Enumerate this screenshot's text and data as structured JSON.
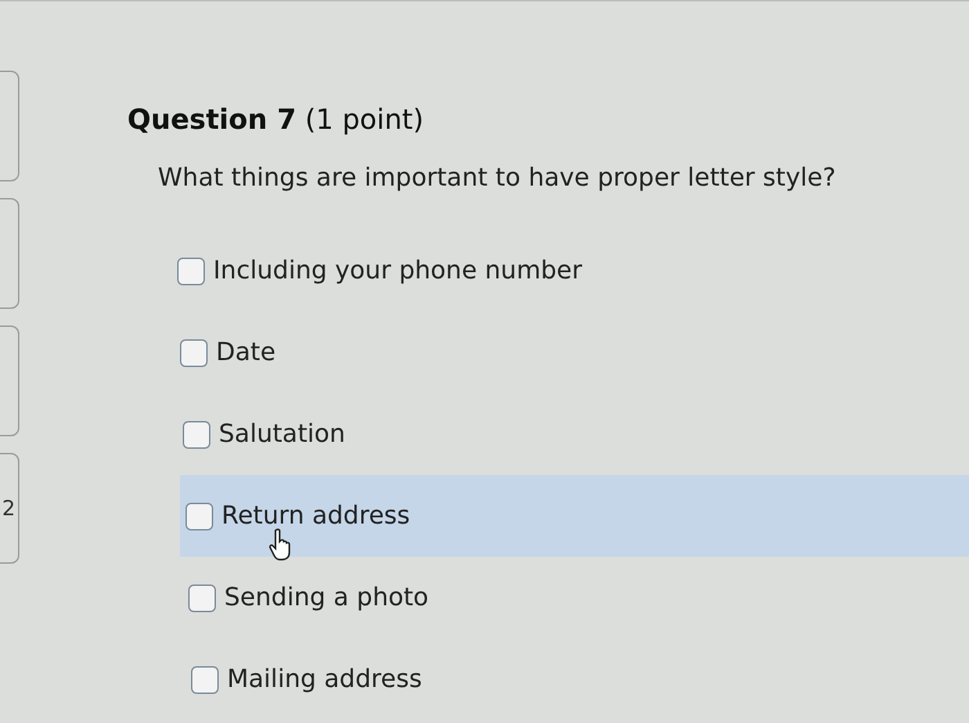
{
  "sidebar": {
    "cards": [
      {
        "selected": false
      },
      {
        "selected": false
      },
      {
        "selected": false
      },
      {
        "text": "2",
        "selected": false
      }
    ]
  },
  "question": {
    "title": "**Question 7** (1 point)",
    "prompt": "What things are important to have proper letter style?",
    "options": [
      {
        "label": "Including your phone number",
        "checked": false,
        "highlighted": false
      },
      {
        "label": "Date",
        "checked": false,
        "highlighted": false
      },
      {
        "label": "Salutation",
        "checked": false,
        "highlighted": false
      },
      {
        "label": "Return address",
        "checked": false,
        "highlighted": true
      },
      {
        "label": "Sending a photo",
        "checked": false,
        "highlighted": false
      },
      {
        "label": "Mailing address",
        "checked": false,
        "highlighted": false
      }
    ]
  }
}
